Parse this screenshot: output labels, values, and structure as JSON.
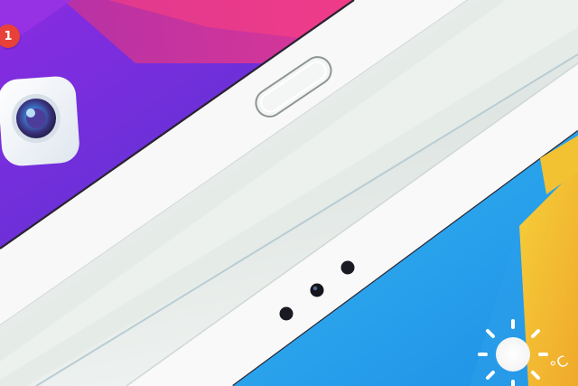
{
  "screen_top": {
    "notification_badge": "1",
    "app_icon": "camera-icon"
  },
  "hardware": {
    "home_button": "home-button-icon",
    "front_camera": "front-camera-icon",
    "sensor_left": "sensor-dot",
    "sensor_right": "sensor-dot"
  },
  "screen_bottom": {
    "weather_icon": "sun-icon",
    "temperature_unit": "°C"
  },
  "colors": {
    "wallpaper_purple": "#7a2fd8",
    "wallpaper_blue": "#2ea7ee",
    "wallpaper_yellow": "#f1c232",
    "bezel_white": "#f7f8f7",
    "frame_silver": "#dde3e0",
    "badge_red": "#e8413a"
  }
}
